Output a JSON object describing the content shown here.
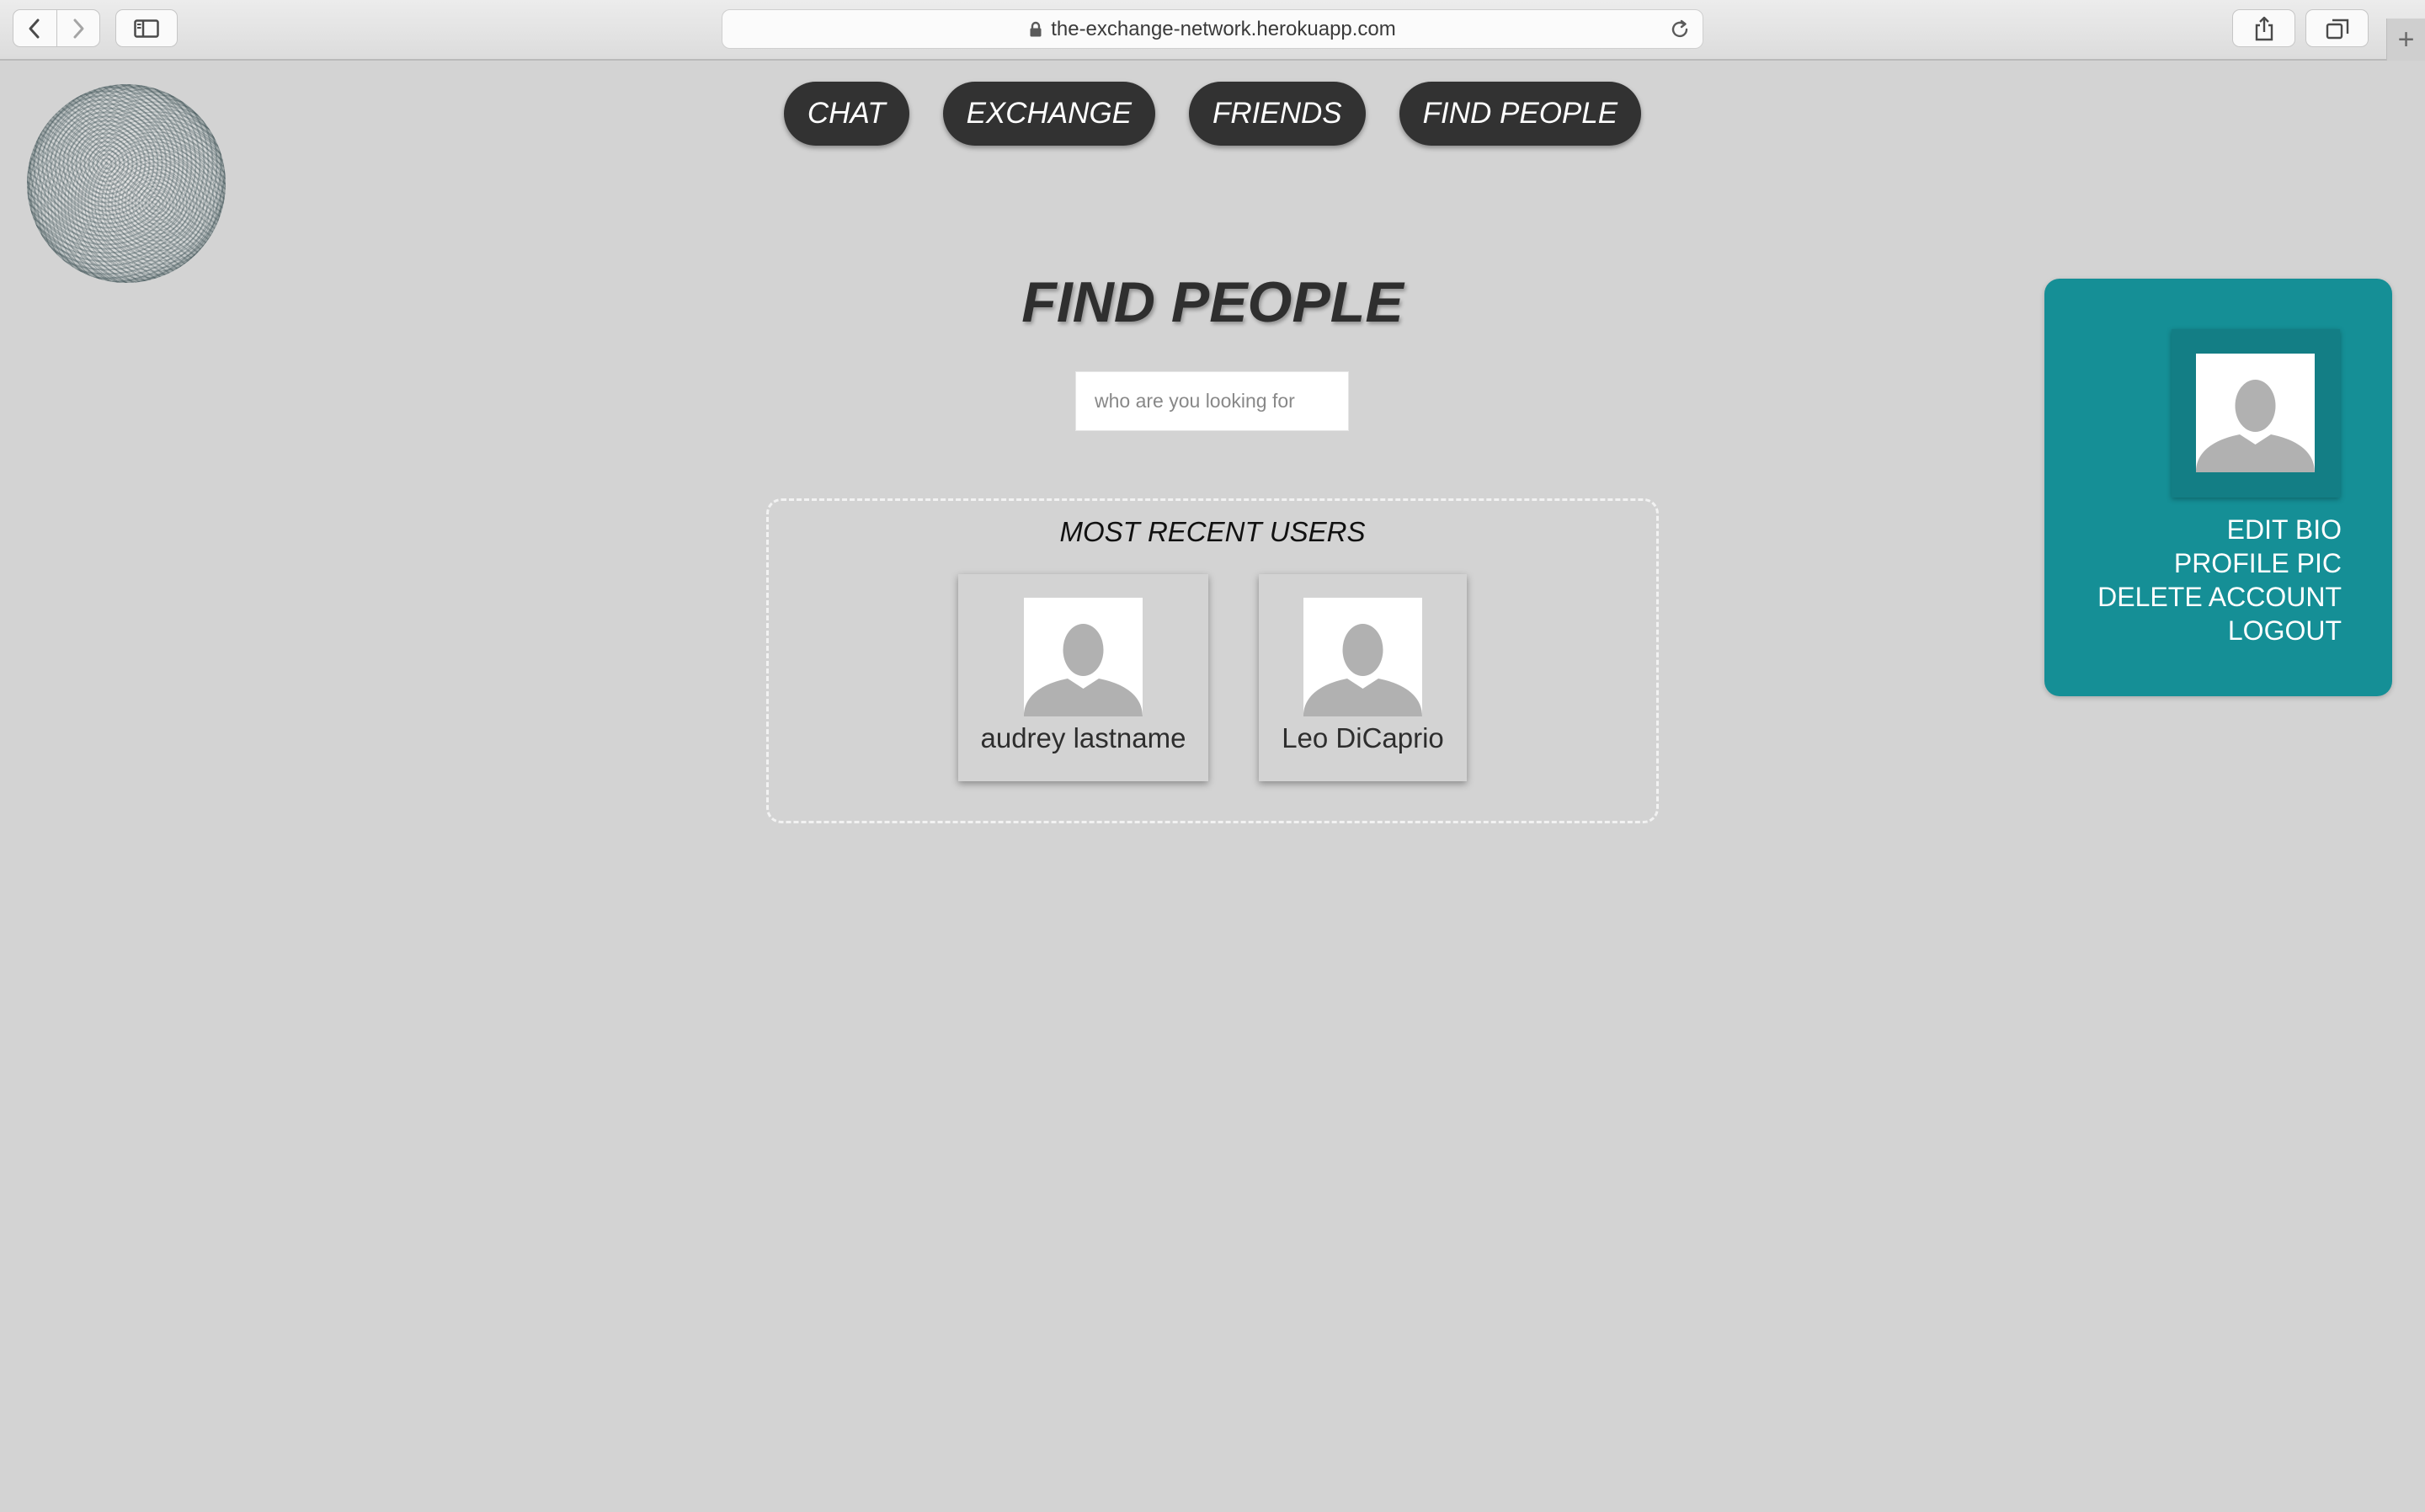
{
  "browser": {
    "url": "the-exchange-network.herokuapp.com",
    "new_tab": "+"
  },
  "nav": {
    "items": [
      "CHAT",
      "EXCHANGE",
      "FRIENDS",
      "FIND PEOPLE"
    ]
  },
  "page": {
    "title": "FIND PEOPLE",
    "search_placeholder": "who are you looking for"
  },
  "recent": {
    "title": "MOST RECENT USERS",
    "users": [
      {
        "name": "audrey lastname"
      },
      {
        "name": "Leo DiCaprio"
      }
    ]
  },
  "profile_menu": {
    "items": [
      "EDIT BIO",
      "PROFILE PIC",
      "DELETE ACCOUNT",
      "LOGOUT"
    ]
  },
  "colors": {
    "page_bg": "#d3d3d3",
    "pill_bg": "#323232",
    "panel_bg": "#158f96"
  },
  "icons": [
    "back-icon",
    "forward-icon",
    "sidebar-icon",
    "lock-icon",
    "reload-icon",
    "share-icon",
    "tabs-icon",
    "user-silhouette-icon"
  ]
}
